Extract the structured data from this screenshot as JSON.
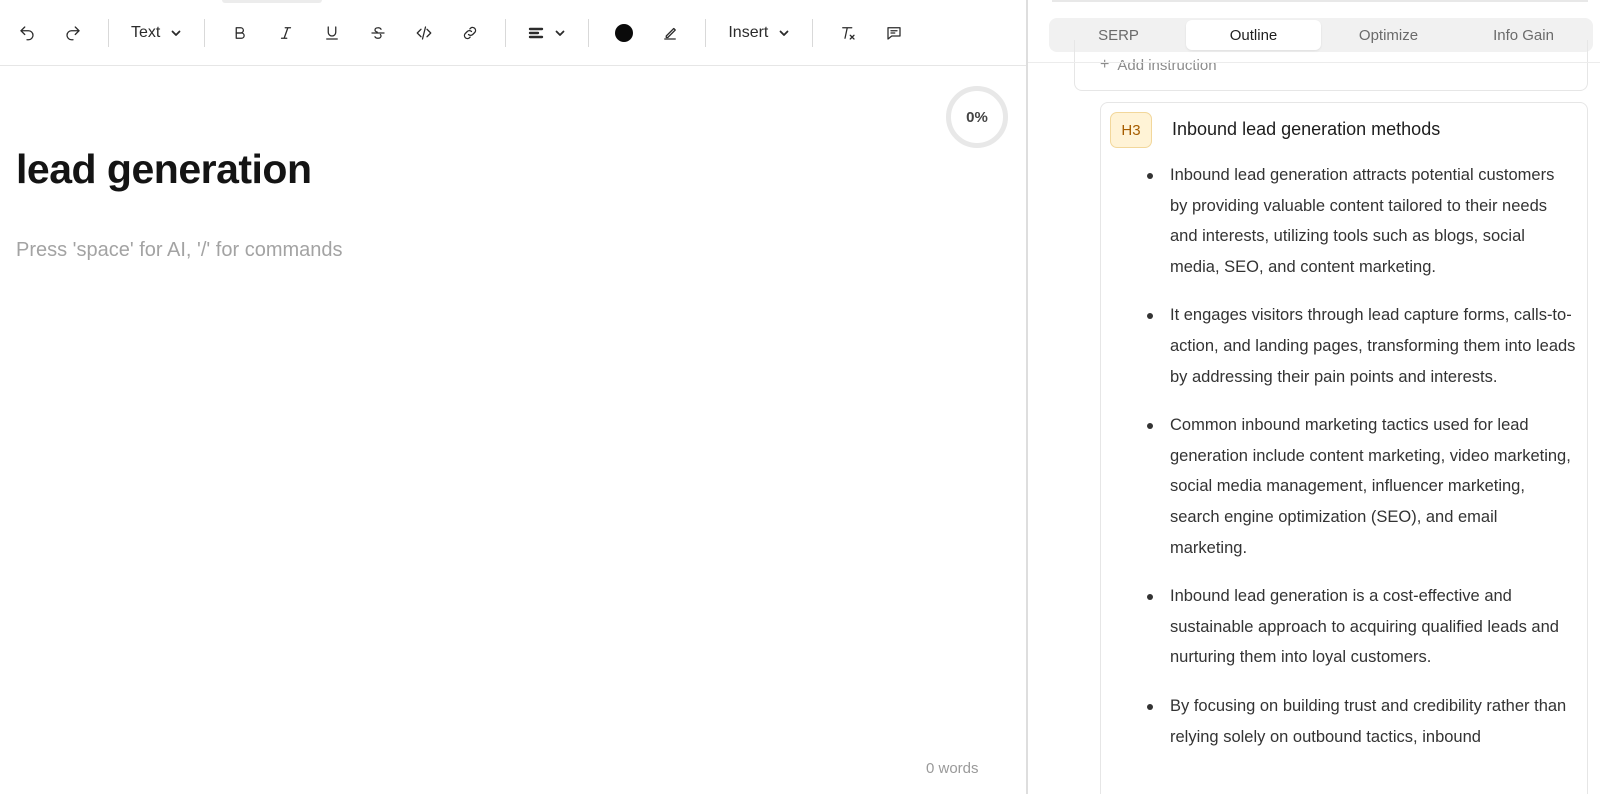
{
  "toolbar": {
    "text_style": "Text",
    "insert": "Insert"
  },
  "editor": {
    "progress": "0%",
    "title": "lead generation",
    "placeholder": "Press 'space' for AI, '/' for commands",
    "word_count": "0 words"
  },
  "panel": {
    "tabs": [
      {
        "label": "SERP"
      },
      {
        "label": "Outline"
      },
      {
        "label": "Optimize"
      },
      {
        "label": "Info Gain"
      }
    ],
    "active_tab": "Outline",
    "add_instruction": "Add instruction",
    "section": {
      "level": "H3",
      "heading": "Inbound lead generation methods",
      "bullets": [
        "Inbound lead generation attracts potential customers by providing valuable content tailored to their needs and interests, utilizing tools such as blogs, social media, SEO, and content marketing.",
        "It engages visitors through lead capture forms, calls-to-action, and landing pages, transforming them into leads by addressing their pain points and interests.",
        "Common inbound marketing tactics used for lead generation include content marketing, video marketing, social media management, influencer marketing, search engine optimization (SEO), and email marketing.",
        "Inbound lead generation is a cost-effective and sustainable approach to acquiring qualified leads and nurturing them into loyal customers.",
        "By focusing on building trust and credibility rather than relying solely on outbound tactics, inbound"
      ]
    }
  }
}
